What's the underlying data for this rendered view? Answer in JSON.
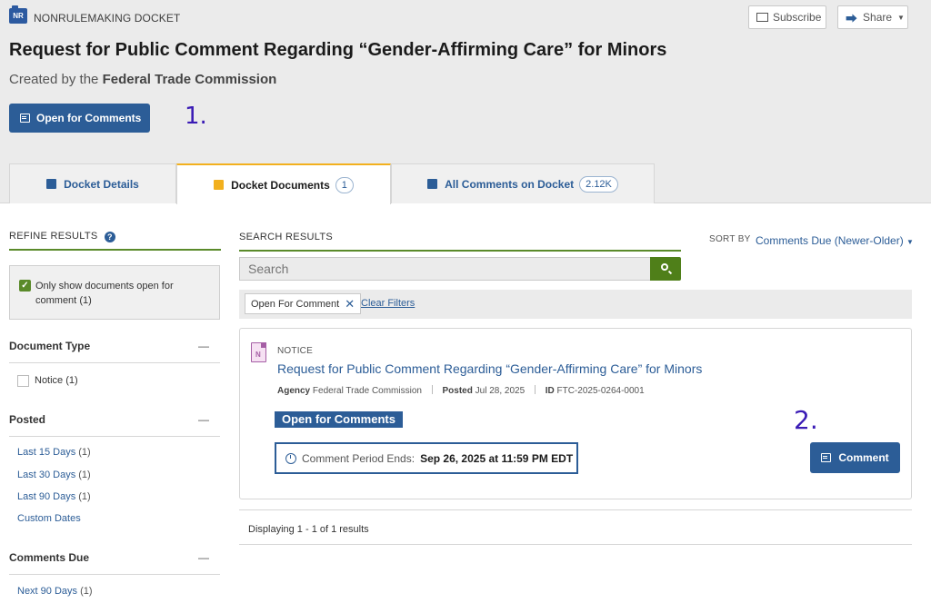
{
  "header": {
    "badge": "NR",
    "docket_type": "NONRULEMAKING DOCKET",
    "title": "Request for Public Comment Regarding “Gender-Affirming Care” for Minors",
    "created_prefix": "Created by the",
    "agency": "Federal Trade Commission",
    "open_button": "Open for Comments",
    "subscribe": "Subscribe",
    "share": "Share",
    "annotation": "1."
  },
  "tabs": [
    {
      "label": "Docket Details",
      "icon": "folder-icon"
    },
    {
      "label": "Docket Documents",
      "count": "1",
      "icon": "document-icon",
      "active": true
    },
    {
      "label": "All Comments on Docket",
      "count": "2.12K",
      "icon": "document-icon"
    }
  ],
  "sidebar": {
    "refine_title": "REFINE RESULTS",
    "help_glyph": "?",
    "open_filter_label": "Only show documents open for comment",
    "open_filter_count": "(1)",
    "document_type_title": "Document Type",
    "document_type_items": [
      {
        "label": "Notice",
        "count": "(1)"
      }
    ],
    "posted_title": "Posted",
    "posted_items": [
      {
        "label": "Last 15 Days",
        "count": "(1)"
      },
      {
        "label": "Last 30 Days",
        "count": "(1)"
      },
      {
        "label": "Last 90 Days",
        "count": "(1)"
      },
      {
        "label": "Custom Dates",
        "count": ""
      }
    ],
    "comments_due_title": "Comments Due",
    "comments_due_items": [
      {
        "label": "Next 90 Days",
        "count": "(1)"
      }
    ],
    "collapse_glyph": "—"
  },
  "main": {
    "search_results_title": "SEARCH RESULTS",
    "sort_label": "SORT BY",
    "sort_value": "Comments Due (Newer-Older)",
    "search_placeholder": "Search",
    "filter_chip": "Open For Comment",
    "clear_filters": "Clear Filters",
    "result": {
      "icon_letter": "N",
      "type": "NOTICE",
      "title": "Request for Public Comment Regarding “Gender-Affirming Care” for Minors",
      "agency_label": "Agency",
      "agency": "Federal Trade Commission",
      "posted_label": "Posted",
      "posted": "Jul 28, 2025",
      "id_label": "ID",
      "id": "FTC-2025-0264-0001",
      "status": "Open for Comments",
      "period_label": "Comment Period Ends:",
      "period_value": "Sep 26, 2025 at 11:59 PM EDT",
      "comment_button": "Comment"
    },
    "annotation": "2.",
    "displaying": "Displaying 1 - 1 of 1 results"
  },
  "colors": {
    "primary": "#2c5d97",
    "green": "#4f7f19",
    "tab_accent": "#f2b01e",
    "annotation": "#3a1bb5"
  }
}
